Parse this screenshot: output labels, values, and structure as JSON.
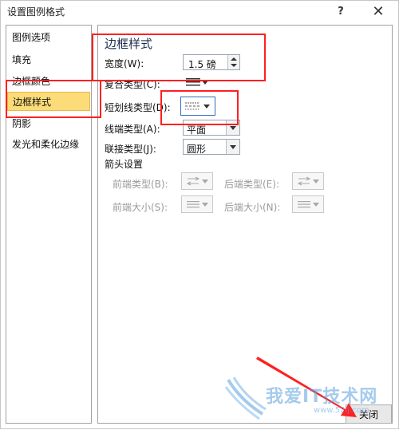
{
  "window": {
    "title": "设置图例格式",
    "help": "?",
    "close": "✕"
  },
  "nav": {
    "items": [
      {
        "label": "图例选项"
      },
      {
        "label": "填充"
      },
      {
        "label": "边框颜色"
      },
      {
        "label": "边框样式",
        "selected": true
      },
      {
        "label": "阴影"
      },
      {
        "label": "发光和柔化边缘"
      }
    ]
  },
  "border_style": {
    "section_title": "边框样式",
    "width_label": "宽度(W):",
    "width_value": "1.5 磅",
    "compound_label": "复合类型(C):",
    "dash_label": "短划线类型(D):",
    "cap_label": "线端类型(A):",
    "cap_value": "平面",
    "join_label": "联接类型(J):",
    "join_value": "圆形",
    "arrow_section": "箭头设置",
    "begin_type": "前端类型(B):",
    "end_type": "后端类型(E):",
    "begin_size": "前端大小(S):",
    "end_size": "后端大小(N):"
  },
  "footer": {
    "close_label": "关闭"
  },
  "watermark": {
    "text": "我爱IT技术网",
    "sub": "www.52ij.com"
  },
  "colors": {
    "selected_bg": "#fbdc78",
    "annotation": "#ff2020",
    "focus": "#2f6fbd"
  }
}
